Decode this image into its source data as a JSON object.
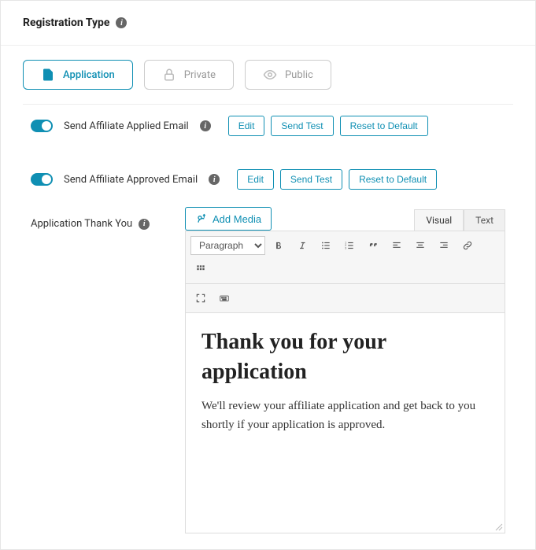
{
  "header": {
    "title": "Registration Type"
  },
  "tabs": [
    {
      "label": "Application",
      "active": true
    },
    {
      "label": "Private",
      "active": false
    },
    {
      "label": "Public",
      "active": false
    }
  ],
  "emailOptions": {
    "applied": {
      "label": "Send Affiliate Applied Email",
      "buttons": {
        "edit": "Edit",
        "sendTest": "Send Test",
        "reset": "Reset to Default"
      }
    },
    "approved": {
      "label": "Send Affiliate Approved Email",
      "buttons": {
        "edit": "Edit",
        "sendTest": "Send Test",
        "reset": "Reset to Default"
      }
    }
  },
  "thankYou": {
    "label": "Application Thank You",
    "addMedia": "Add Media",
    "editorTabs": {
      "visual": "Visual",
      "text": "Text"
    },
    "formatSelect": "Paragraph",
    "content": {
      "heading": "Thank you for your application",
      "body": "We'll review your affiliate application and get back to you shortly if your application is approved."
    }
  }
}
